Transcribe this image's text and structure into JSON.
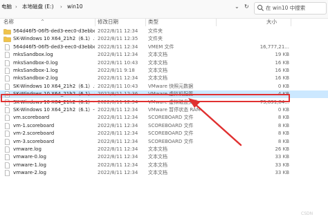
{
  "breadcrumb": {
    "pc": "电脑",
    "disk": "本地磁盘 (E:)",
    "folder": "win10"
  },
  "search": {
    "placeholder": "在 win10 中搜索"
  },
  "columns": {
    "name": "名称",
    "date": "修改日期",
    "type": "类型",
    "size": "大小"
  },
  "sort_glyph": "^",
  "files": [
    {
      "icon": "folder-icon",
      "name": "564d46f5-06f5-ded3-eec0-d3ebbdce...",
      "date": "2022/8/11 12:34",
      "type": "文件夹",
      "size": ""
    },
    {
      "icon": "folder-icon",
      "name": "SK-Windows 10 X64_21h2（6.1）.vmx...",
      "date": "2022/8/11 12:35",
      "type": "文件夹",
      "size": ""
    },
    {
      "icon": "file-icon",
      "name": "564d46f5-06f5-ded3-eec0-d3ebbdce...",
      "date": "2022/8/11 12:34",
      "type": "VMEM 文件",
      "size": "16,777,21..."
    },
    {
      "icon": "file-icon",
      "name": "mksSandbox.log",
      "date": "2022/8/11 12:34",
      "type": "文本文档",
      "size": "19 KB"
    },
    {
      "icon": "file-icon",
      "name": "mksSandbox-0.log",
      "date": "2022/8/11 10:43",
      "type": "文本文档",
      "size": "16 KB"
    },
    {
      "icon": "file-icon",
      "name": "mksSandbox-1.log",
      "date": "2022/8/11 9:18",
      "type": "文本文档",
      "size": "16 KB"
    },
    {
      "icon": "file-icon",
      "name": "mksSandbox-2.log",
      "date": "2022/8/11 12:34",
      "type": "文本文档",
      "size": "16 KB"
    },
    {
      "icon": "file-icon",
      "name": "SK-Windows 10 X64_21h2（6.1）.vmsd",
      "date": "2022/8/11 10:43",
      "type": "VMware 快照元数据",
      "size": "0 KB"
    },
    {
      "icon": "vmx-icon",
      "name": "SK-Windows 10 X64_21h2（6.1）.vmx",
      "date": "2022/8/11 12:36",
      "type": "VMware 虚拟机配置",
      "size": "4 KB"
    },
    {
      "icon": "file-icon",
      "name": "SK-Windows 10 X64_21h2（6.1）-dis...",
      "date": "2022/8/11 12:34",
      "type": "VMware 虚拟磁盘文件",
      "size": "73,891,84..."
    },
    {
      "icon": "file-icon",
      "name": "SK-Windows 10 X64_21h2（6.1）-file...",
      "date": "2022/8/11 12:34",
      "type": "VMware 暂停状态 RAM",
      "size": "0 KB"
    },
    {
      "icon": "file-icon",
      "name": "vm.scoreboard",
      "date": "2022/8/11 12:34",
      "type": "SCOREBOARD 文件",
      "size": "8 KB"
    },
    {
      "icon": "file-icon",
      "name": "vm-1.scoreboard",
      "date": "2022/8/11 12:34",
      "type": "SCOREBOARD 文件",
      "size": "8 KB"
    },
    {
      "icon": "file-icon",
      "name": "vm-2.scoreboard",
      "date": "2022/8/11 12:34",
      "type": "SCOREBOARD 文件",
      "size": "8 KB"
    },
    {
      "icon": "file-icon",
      "name": "vm-3.scoreboard",
      "date": "2022/8/11 12:34",
      "type": "SCOREBOARD 文件",
      "size": "8 KB"
    },
    {
      "icon": "file-icon",
      "name": "vmware.log",
      "date": "2022/8/11 12:34",
      "type": "文本文档",
      "size": "26 KB"
    },
    {
      "icon": "file-icon",
      "name": "vmware-0.log",
      "date": "2022/8/11 12:34",
      "type": "文本文档",
      "size": "33 KB"
    },
    {
      "icon": "file-icon",
      "name": "vmware-1.log",
      "date": "2022/8/11 12:34",
      "type": "文本文档",
      "size": "33 KB"
    },
    {
      "icon": "file-icon",
      "name": "vmware-2.log",
      "date": "2022/8/11 12:34",
      "type": "文本文档",
      "size": "33 KB"
    }
  ],
  "watermark": "CSDN",
  "colors": {
    "selection": "#cce8ff",
    "highlight": "#e03030",
    "folder": "#f0c34a"
  }
}
